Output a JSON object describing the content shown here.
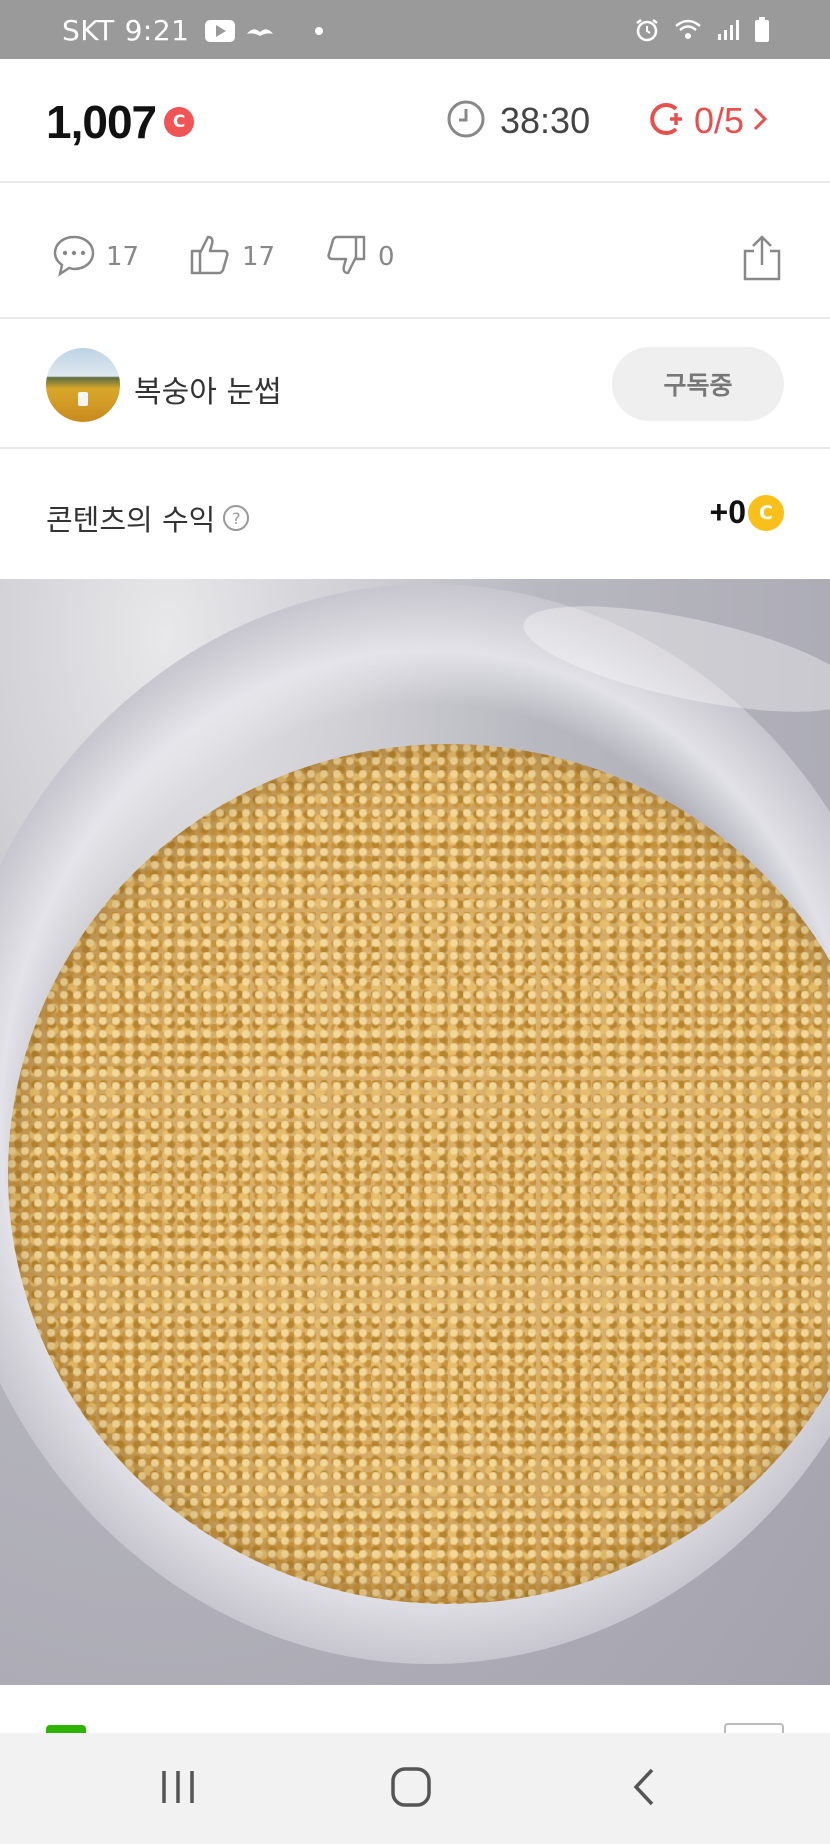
{
  "status_bar": {
    "carrier": "SKT",
    "time": "9:21",
    "icons": [
      "youtube-icon",
      "mustache-icon",
      "dot-icon",
      "alarm-icon",
      "wifi-icon",
      "signal-icon",
      "battery-icon"
    ]
  },
  "header": {
    "points": "1,007",
    "points_coin": "C",
    "timer": "38:30",
    "quota": "0/5"
  },
  "actions": {
    "comments": "17",
    "likes": "17",
    "dislikes": "0"
  },
  "author": {
    "name": "복숭아 눈썹",
    "subscribe_label": "구독중"
  },
  "revenue": {
    "label": "콘텐츠의 수익",
    "help": "?",
    "amount": "+0",
    "coin": "C"
  },
  "colors": {
    "accent_red": "#e8504e",
    "coin_yellow": "#f9c01b",
    "status_bar": "#9a9a9a"
  }
}
